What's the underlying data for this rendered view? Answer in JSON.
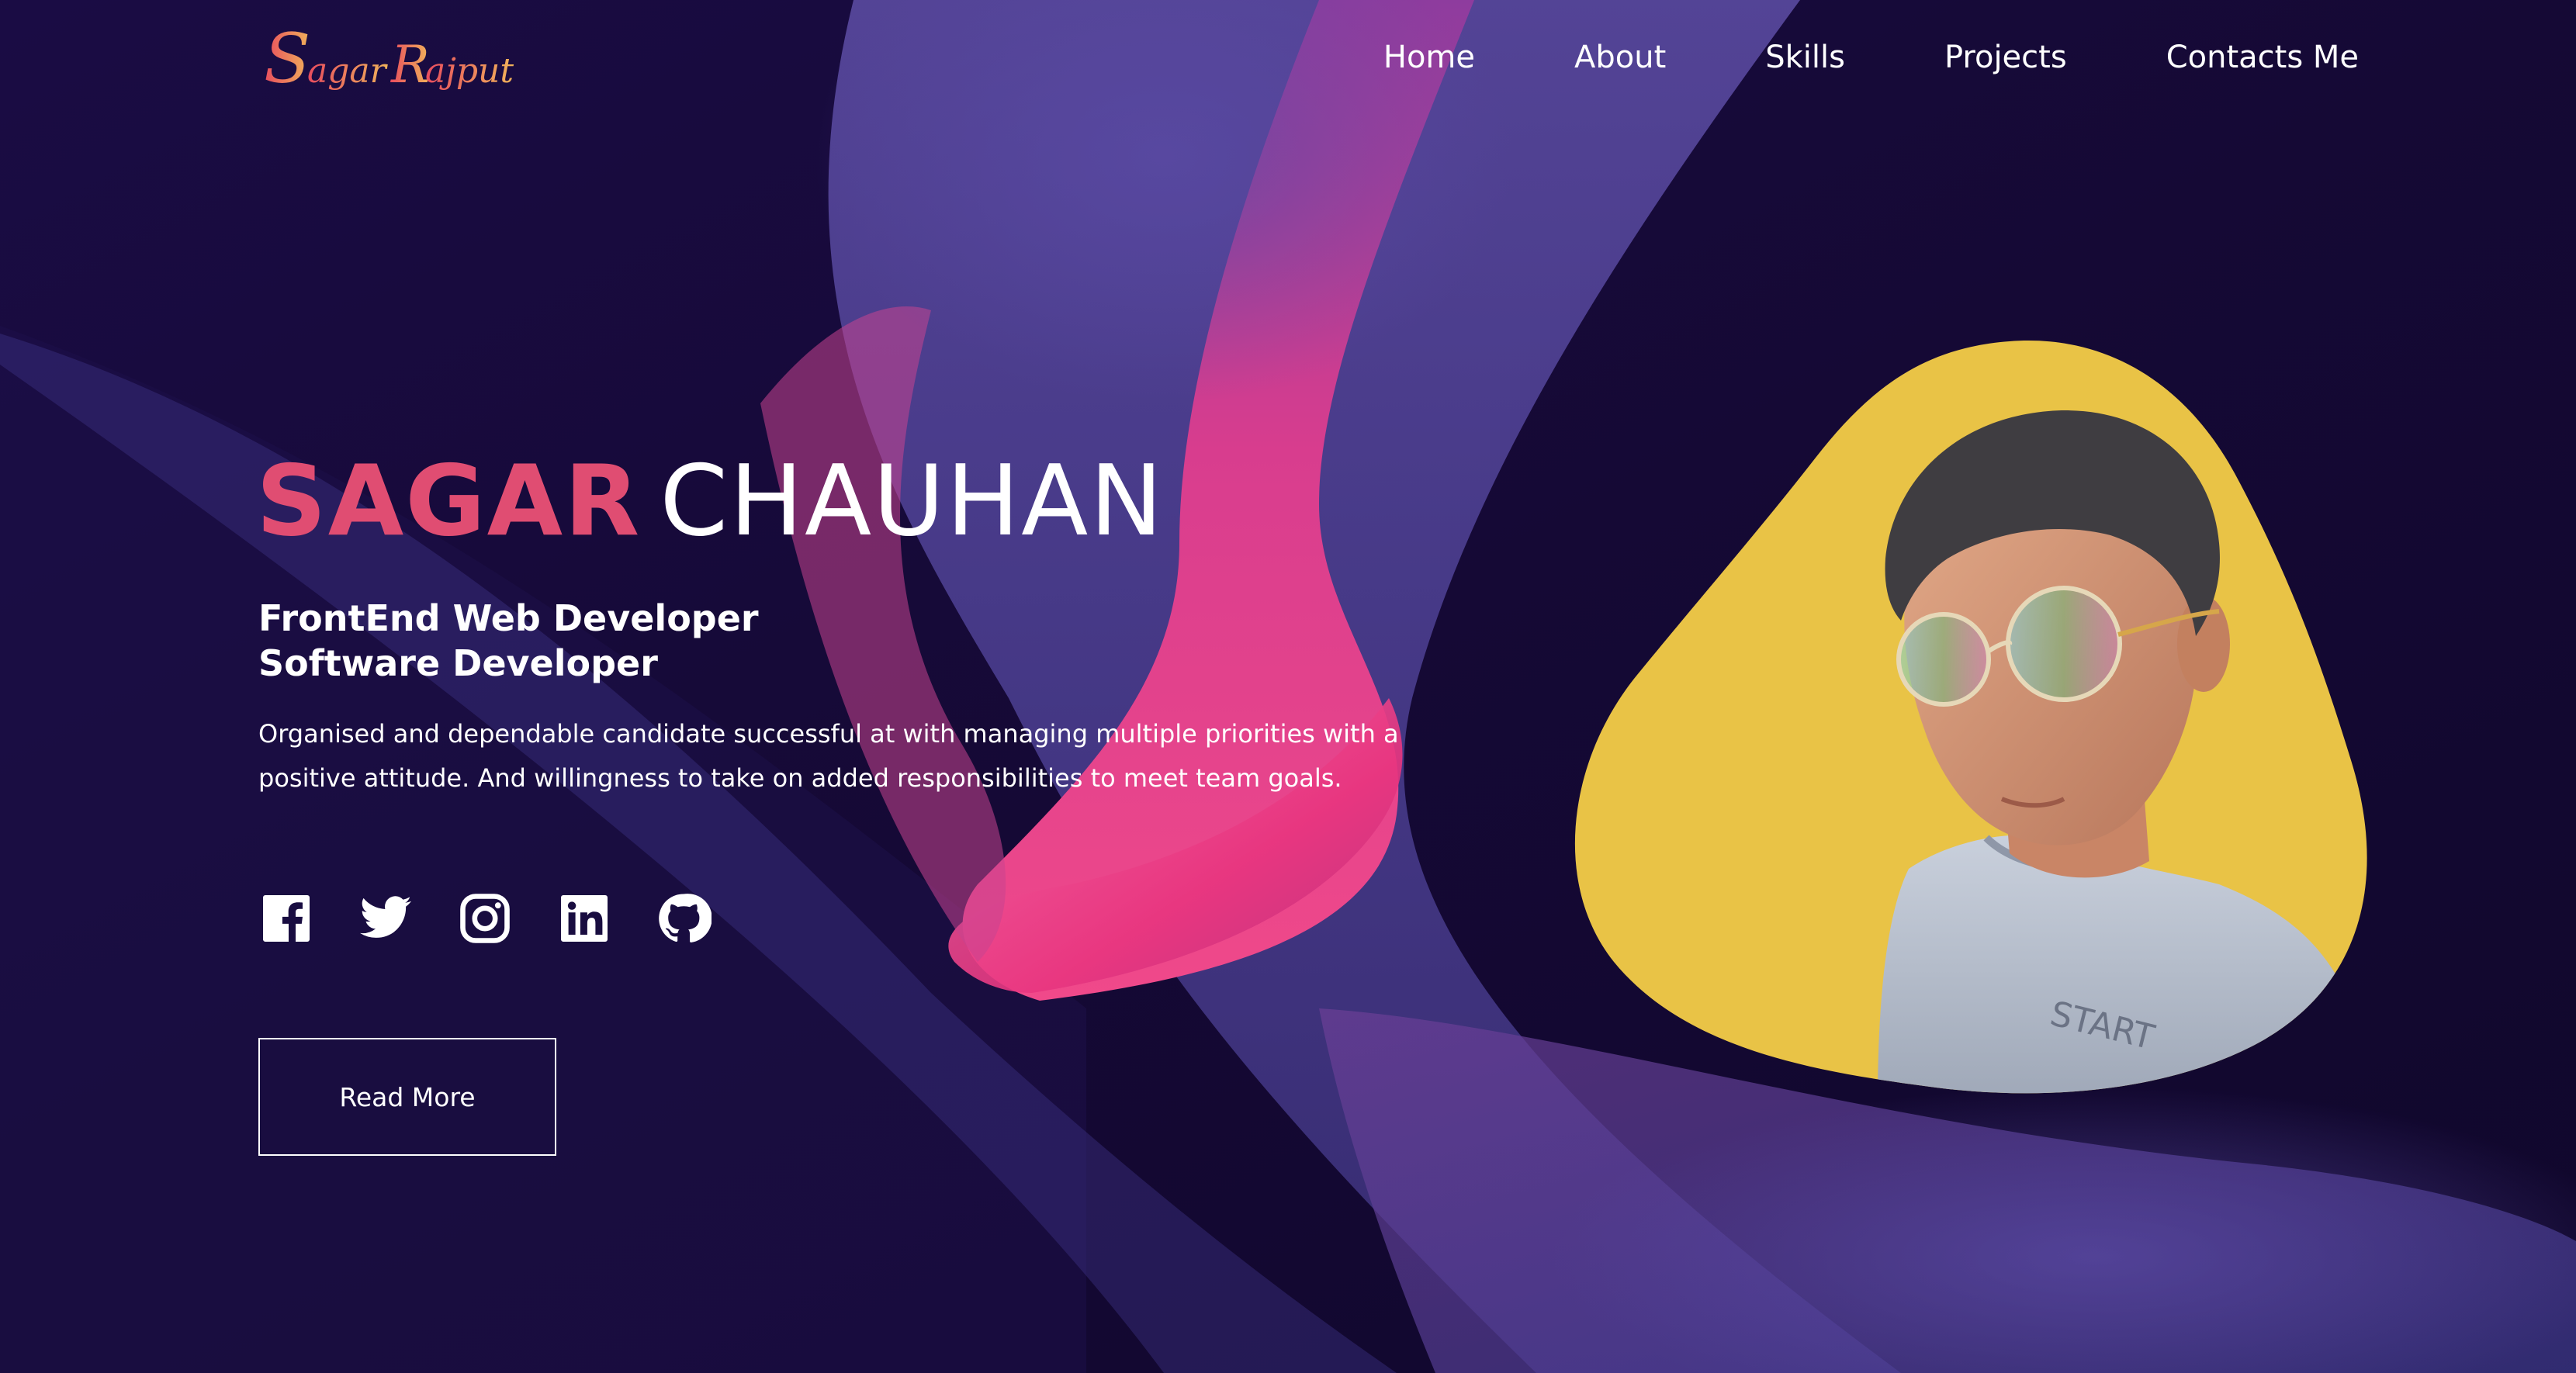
{
  "logo": {
    "first": "Sagar",
    "last": "Rajput"
  },
  "nav": {
    "items": [
      {
        "label": "Home"
      },
      {
        "label": "About"
      },
      {
        "label": "Skills"
      },
      {
        "label": "Projects"
      },
      {
        "label": "Contacts Me"
      }
    ]
  },
  "hero": {
    "first_name": "SAGAR",
    "last_name": "CHAUHAN",
    "roles": [
      "FrontEnd Web Developer",
      "Software Developer"
    ],
    "bio": "Organised and dependable candidate successful at with managing multiple priorities with a positive attitude. And willingness to take on added responsibilities to meet team goals.",
    "read_more_label": "Read More"
  },
  "social": {
    "icons": [
      "facebook-icon",
      "twitter-icon",
      "instagram-icon",
      "linkedin-icon",
      "github-icon"
    ]
  },
  "colors": {
    "background": "#12082f",
    "accent": "#e04d72",
    "blob": "#e9c346",
    "text": "#ffffff"
  }
}
